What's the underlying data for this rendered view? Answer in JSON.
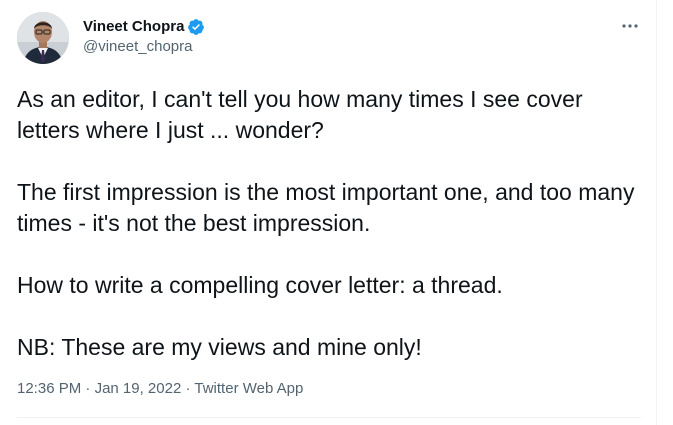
{
  "author": {
    "display_name": "Vineet Chopra",
    "handle": "@vineet_chopra",
    "verified": true
  },
  "tweet": {
    "paragraphs": [
      "As an editor, I can't tell you how many times I see cover letters where I just ... wonder?",
      "The first impression is the most important one, and too many times - it's not the best impression.",
      "How to write a compelling cover letter: a thread.",
      "NB: These are my views and mine only!"
    ]
  },
  "meta": {
    "time": "12:36 PM",
    "separator": "·",
    "date": "Jan 19, 2022",
    "source": "Twitter Web App"
  },
  "icons": {
    "verified": "verified-badge-icon",
    "more": "more-options-icon"
  },
  "colors": {
    "verified_blue": "#1d9bf0",
    "secondary_text": "#536471",
    "primary_text": "#0f1419",
    "divider": "#eff3f4"
  }
}
